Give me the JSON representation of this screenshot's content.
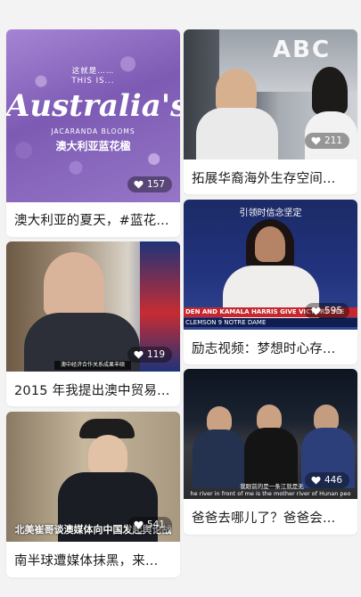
{
  "feed": {
    "left": [
      {
        "caption": "澳大利亚的夏天，#蓝花...",
        "likes": "157",
        "overlay": {
          "line1": "这就是……",
          "line2": "THIS IS...",
          "title": "Australia's",
          "tag": "JACARANDA BLOOMS",
          "zh": "澳大利亚蓝花楹"
        }
      },
      {
        "caption": "2015 年我提出澳中贸易...",
        "likes": "119",
        "overlay": {
          "subtitle": "澳中经济合作关系成果丰硕"
        }
      },
      {
        "caption": "南半球遭媒体抹黑，来...",
        "likes": "541",
        "overlay": {
          "subtitle": "北美崔哥谈澳媒体向中国发起舆论战"
        }
      }
    ],
    "right": [
      {
        "caption": "拓展华裔海外生存空间...",
        "likes": "211",
        "overlay": {
          "sign": "ABC"
        }
      },
      {
        "caption": "励志视频：梦想时心存...",
        "likes": "595",
        "overlay": {
          "top": "引领时信念坚定",
          "band1": "DEN AND KAMALA HARRIS GIVE VICTORY SPE",
          "band2": "CLEMSON 9 NOTRE DAME"
        }
      },
      {
        "caption": "爸爸去哪儿了？爸爸会...",
        "likes": "446",
        "overlay": {
          "sub1": "我眼前的是一条江就是无",
          "sub2": "he river in front of me is the mother river of Hunan peo"
        }
      }
    ]
  },
  "colors": {
    "accent": "#ffffff",
    "page_bg": "#f3f3f3",
    "card_bg": "#ffffff"
  },
  "icons": {
    "like": "heart-icon"
  }
}
